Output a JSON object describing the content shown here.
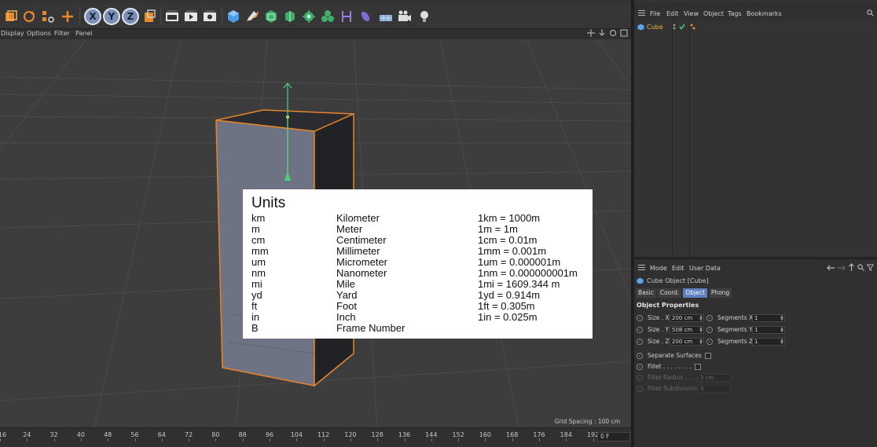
{
  "toolbar": {
    "axis_x": "X",
    "axis_y": "Y",
    "axis_z": "Z"
  },
  "viewport": {
    "menu": [
      "Display",
      "Options",
      "Filter",
      "Panel"
    ],
    "grid_spacing": "Grid Spacing : 100 cm"
  },
  "units": {
    "title": "Units",
    "rows": [
      {
        "abbr": "km",
        "name": "Kilometer",
        "eq": "1km = 1000m"
      },
      {
        "abbr": "m",
        "name": "Meter",
        "eq": "1m = 1m"
      },
      {
        "abbr": "cm",
        "name": "Centimeter",
        "eq": "1cm = 0.01m"
      },
      {
        "abbr": "mm",
        "name": "Millimeter",
        "eq": "1mm = 0.001m"
      },
      {
        "abbr": "um",
        "name": "Micrometer",
        "eq": "1um = 0.000001m"
      },
      {
        "abbr": "nm",
        "name": "Nanometer",
        "eq": "1nm = 0.000000001m"
      },
      {
        "abbr": "mi",
        "name": "Mile",
        "eq": "1mi = 1609.344 m"
      },
      {
        "abbr": "yd",
        "name": "Yard",
        "eq": "1yd = 0.914m"
      },
      {
        "abbr": "ft",
        "name": "Foot",
        "eq": "1ft = 0.305m"
      },
      {
        "abbr": "in",
        "name": "Inch",
        "eq": "1in = 0.025m"
      },
      {
        "abbr": "B",
        "name": "Frame Number",
        "eq": ""
      }
    ]
  },
  "timeline": {
    "ticks": [
      "16",
      "24",
      "32",
      "40",
      "48",
      "56",
      "64",
      "72",
      "80",
      "88",
      "96",
      "104",
      "112",
      "120",
      "128",
      "136",
      "144",
      "152",
      "160",
      "168",
      "176",
      "184",
      "192"
    ],
    "current_frame": "0 F"
  },
  "object_manager": {
    "menu": [
      "File",
      "Edit",
      "View",
      "Object",
      "Tags",
      "Bookmarks"
    ],
    "object_name": "Cube"
  },
  "attribute_manager": {
    "menu": [
      "Mode",
      "Edit",
      "User Data"
    ],
    "title": "Cube Object [Cube]",
    "tabs": [
      "Basic",
      "Coord.",
      "Object",
      "Phong"
    ],
    "active_tab": "Object",
    "section": "Object Properties",
    "size_x_label": "Size . X",
    "size_x": "200 cm",
    "size_y_label": "Size . Y",
    "size_y": "508 cm",
    "size_z_label": "Size . Z",
    "size_z": "200 cm",
    "seg_x_label": "Segments X",
    "seg_x": "1",
    "seg_y_label": "Segments Y",
    "seg_y": "1",
    "seg_z_label": "Segments Z",
    "seg_z": "1",
    "separate_surfaces": "Separate Surfaces",
    "fillet": "Fillet . . . . . . . .",
    "fillet_radius_label": "Fillet Radius . . . .",
    "fillet_radius": "3 cm",
    "fillet_subdiv_label": "Fillet Subdivision",
    "fillet_subdiv": "3"
  },
  "colors": {
    "selection_orange": "#f08c2a",
    "axis_green": "#4bd17a",
    "accent_blue": "#5f7fbf"
  }
}
